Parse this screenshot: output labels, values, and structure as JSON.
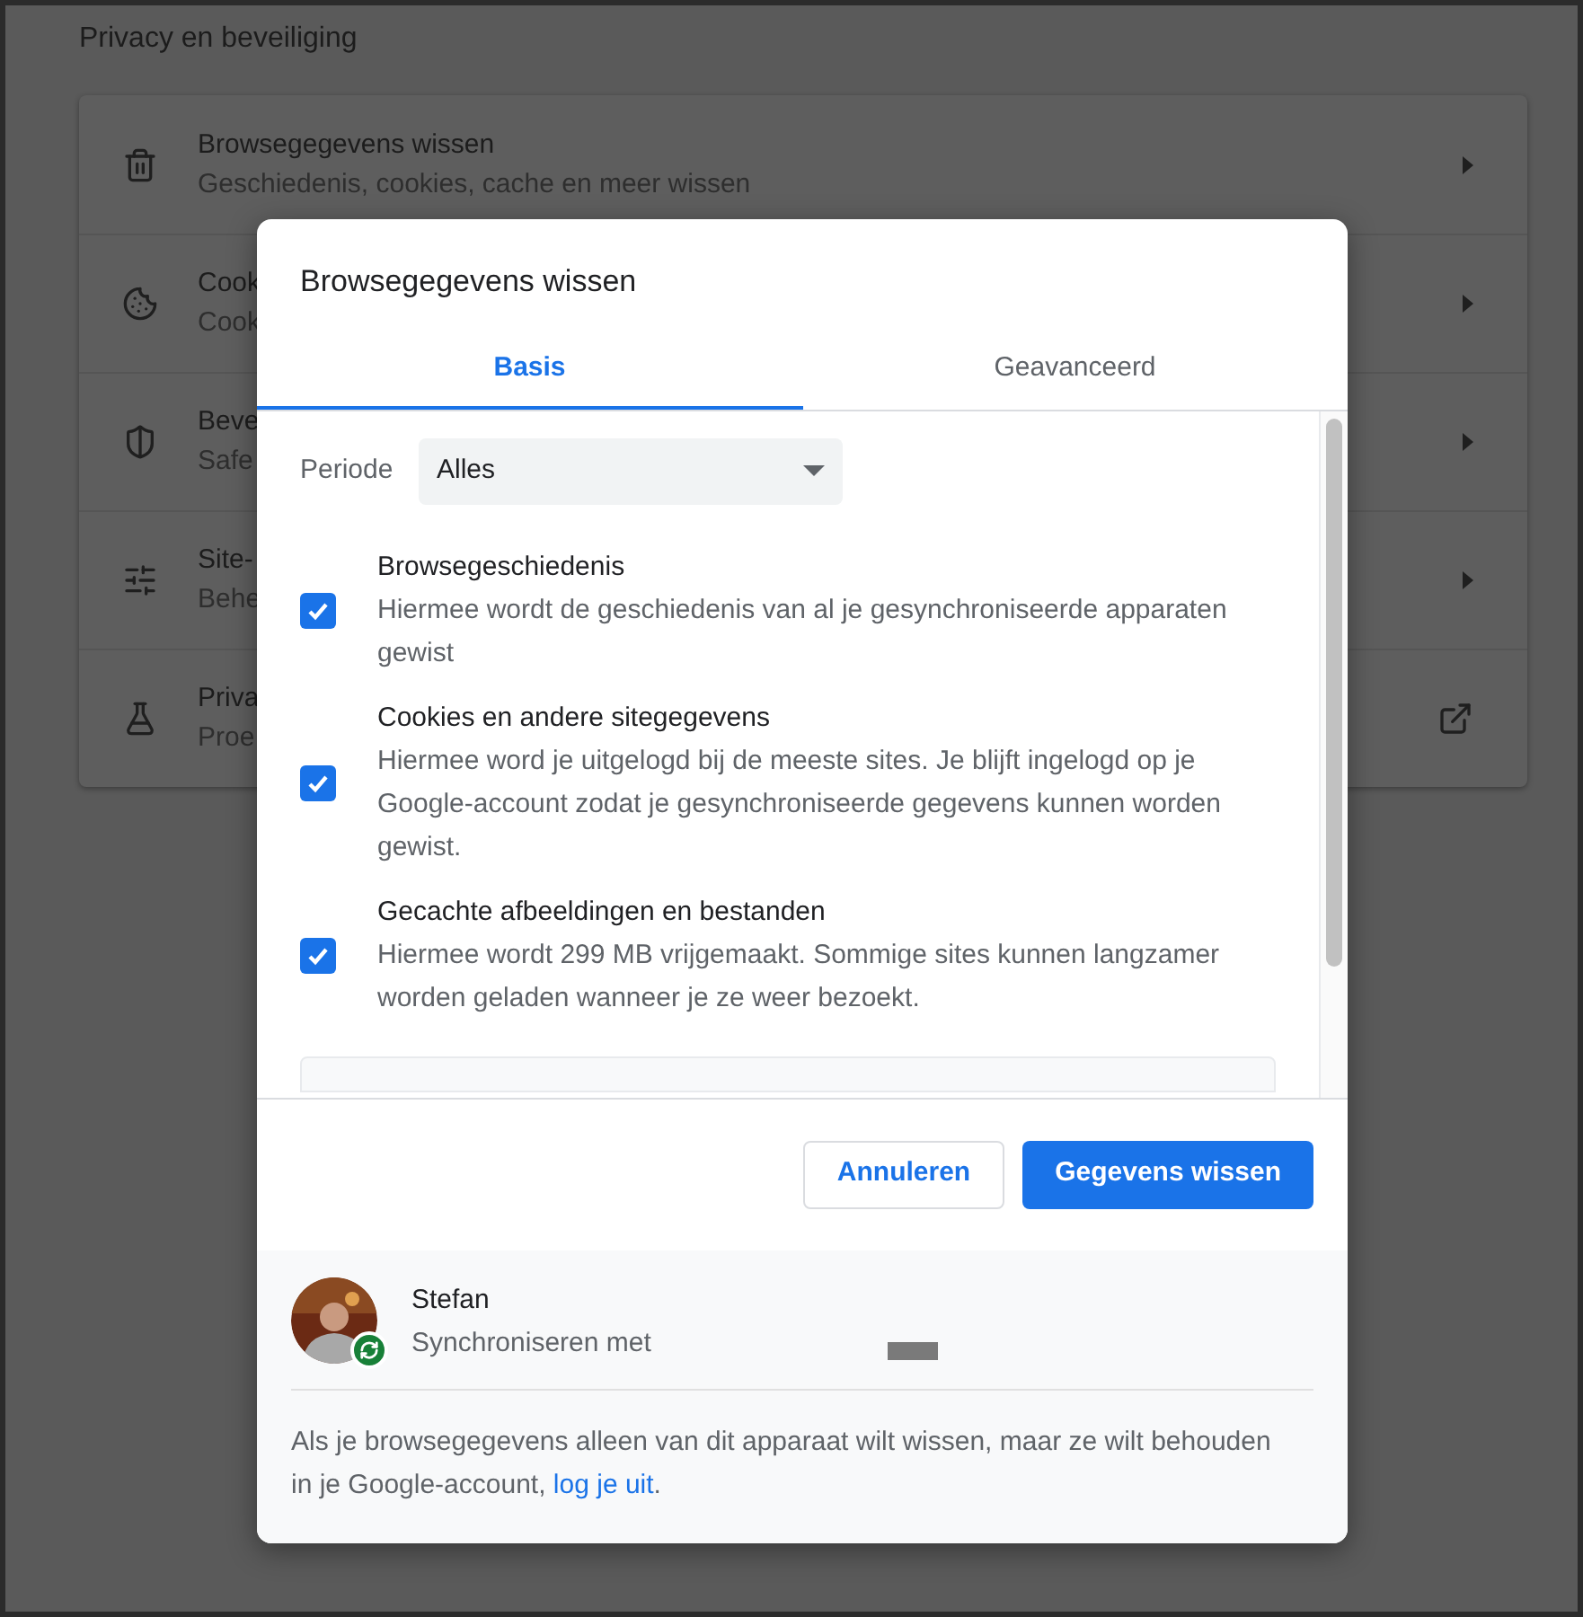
{
  "background": {
    "section_title": "Privacy en beveiliging",
    "rows": [
      {
        "kind": "arrow",
        "title": "Browsegegevens wissen",
        "subtitle": "Geschiedenis, cookies, cache en meer wissen"
      },
      {
        "kind": "arrow",
        "title": "Cook",
        "subtitle": "Cook"
      },
      {
        "kind": "arrow",
        "title": "Beve",
        "subtitle": "Safe"
      },
      {
        "kind": "arrow",
        "title": "Site-",
        "subtitle": "Behe"
      },
      {
        "kind": "external",
        "title": "Priva",
        "subtitle": "Proe"
      }
    ]
  },
  "dialog": {
    "title": "Browsegegevens wissen",
    "tabs": [
      {
        "label": "Basis",
        "selected": true
      },
      {
        "label": "Geavanceerd",
        "selected": false
      }
    ],
    "period": {
      "label": "Periode",
      "value": "Alles"
    },
    "options": [
      {
        "title": "Browsegeschiedenis",
        "description": "Hiermee wordt de geschiedenis van al je gesynchroniseerde apparaten gewist",
        "checked": true
      },
      {
        "title": "Cookies en andere sitegegevens",
        "description": "Hiermee word je uitgelogd bij de meeste sites. Je blijft ingelogd op je Google-account zodat je gesynchroniseerde gegevens kunnen worden gewist.",
        "checked": true
      },
      {
        "title": "Gecachte afbeeldingen en bestanden",
        "description": "Hiermee wordt 299 MB vrijgemaakt. Sommige sites kunnen langzamer worden geladen wanneer je ze weer bezoekt.",
        "checked": true
      }
    ],
    "buttons": [
      {
        "label": "Annuleren",
        "kind": "secondary"
      },
      {
        "label": "Gegevens wissen",
        "kind": "primary"
      }
    ],
    "account": {
      "name": "Stefan",
      "status": "Synchroniseren met"
    },
    "note": {
      "text": "Als je browsegegevens alleen van dit apparaat wilt wissen, maar ze wilt behouden in je Google-account, ",
      "link": "log je uit",
      "end": "."
    }
  }
}
